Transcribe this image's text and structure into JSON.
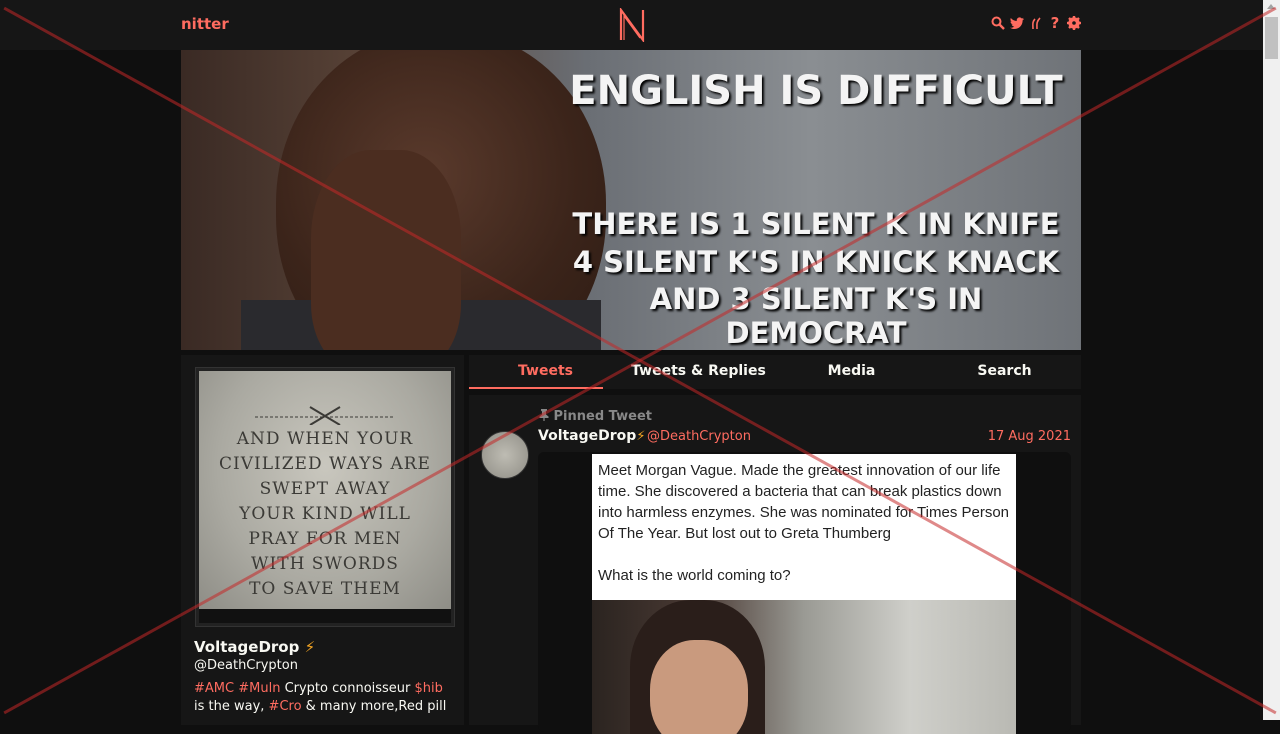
{
  "navbar": {
    "brand": "nitter",
    "logo_letter": "N",
    "icons": [
      "search-icon",
      "twitter-bird-icon",
      "rss-icon",
      "help-icon",
      "gear-icon"
    ],
    "accent_color": "#ff6c60"
  },
  "banner": {
    "line1": "ENGLISH IS DIFFICULT",
    "line2": "THERE IS 1 SILENT K IN KNIFE",
    "line3": "4 SILENT K'S IN KNICK KNACK",
    "line4": "AND 3 SILENT K'S IN DEMOCRAT"
  },
  "profile": {
    "avatar_text": "AND WHEN YOUR CIVILIZED WAYS ARE SWEPT AWAY YOUR KIND WILL PRAY FOR MEN WITH SWORDS TO SAVE THEM",
    "avatar_lines": [
      "AND WHEN YOUR",
      "CIVILIZED WAYS ARE",
      "SWEPT AWAY",
      "YOUR KIND WILL",
      "PRAY FOR MEN",
      "WITH SWORDS",
      "TO SAVE THEM"
    ],
    "display_name": "VoltageDrop",
    "verified_glyph": "⚡",
    "username": "@DeathCrypton",
    "bio": {
      "tag1": "#AMC",
      "tag2": "#Muln",
      "text1": " Crypto connoisseur ",
      "tag3": "$hib",
      "text2": " is the way, ",
      "tag4": "#Cro",
      "text3": " & many more,Red pill"
    }
  },
  "tabs": [
    {
      "label": "Tweets",
      "active": true
    },
    {
      "label": "Tweets & Replies",
      "active": false
    },
    {
      "label": "Media",
      "active": false
    },
    {
      "label": "Search",
      "active": false
    }
  ],
  "tweet": {
    "pinned_label": "Pinned Tweet",
    "display_name": "VoltageDrop",
    "verified_glyph": "⚡",
    "username": "@DeathCrypton",
    "date": "17 Aug 2021",
    "media_text": [
      "Meet Morgan Vague. Made the greatest innovation of our life time. She discovered a bacteria that can break plastics down into harmless enzymes. She was nominated for Times Person Of The Year. But lost out to Greta Thumberg",
      "What is the world coming to?"
    ]
  }
}
